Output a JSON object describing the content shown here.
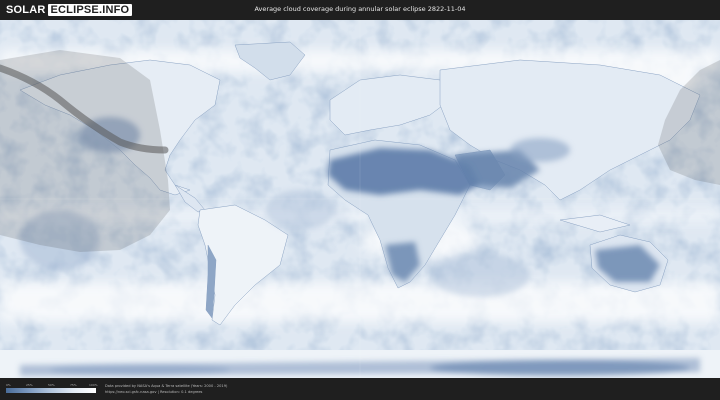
{
  "header": {
    "logo_solar": "SOLAR",
    "logo_eclipse": "ECLIPSE.INFO",
    "title": "Average cloud coverage during annular solar eclipse 2822-11-04"
  },
  "legend": {
    "ticks": [
      "0%",
      "25%",
      "50%",
      "75%",
      "100%"
    ],
    "colors": [
      "#4a6d99",
      "#7d9ac0",
      "#b4c7de",
      "#e3ebf5",
      "#ffffff"
    ]
  },
  "footer": {
    "credit_line1": "Data provided by NASA's Aqua & Terra satellite (Years: 2000 - 2019)",
    "credit_line2": "https://neo.sci.gsfc.nasa.gov | Resolution: 0.1 degrees"
  },
  "map": {
    "ocean_color": "#dce6f1",
    "cloudy_color": "#ffffff",
    "clear_color": "#5a7aa5",
    "eclipse_path_color": "#555555"
  }
}
